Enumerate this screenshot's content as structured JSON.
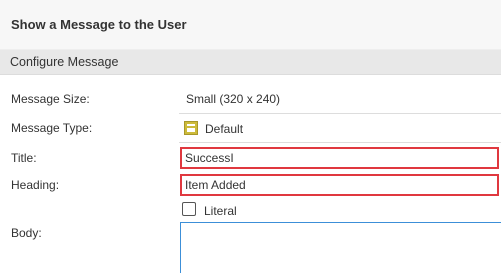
{
  "dialog": {
    "title": "Show a Message to the User"
  },
  "section": {
    "title": "Configure Message"
  },
  "fields": {
    "message_size": {
      "label": "Message Size:",
      "value": "Small (320 x 240)"
    },
    "message_type": {
      "label": "Message Type:",
      "value": "Default",
      "icon": "form-template-icon"
    },
    "title": {
      "label": "Title:",
      "value": "SuccessI"
    },
    "heading": {
      "label": "Heading:",
      "value": "Item Added"
    },
    "literal": {
      "label": "Literal",
      "checked": false
    },
    "body": {
      "label": "Body:",
      "value": ""
    }
  },
  "colors": {
    "error_border": "#e0383f",
    "focus_border": "#3c8fd8",
    "section_bg": "#e8e8e8",
    "icon_yellow": "#cdbb3a"
  }
}
